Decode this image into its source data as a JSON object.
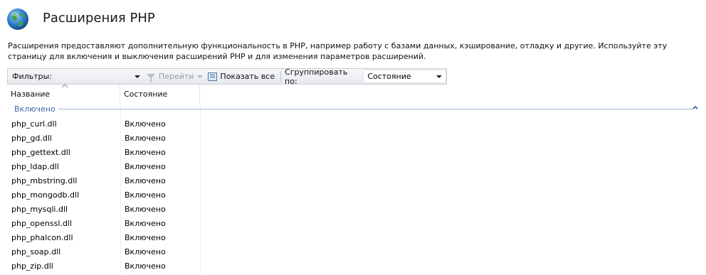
{
  "header": {
    "title": "Расширения PHP",
    "icon": "globe-icon"
  },
  "description": "Расширения предоставляют дополнительную функциональность в PHP, например работу с базами данных, кэширование, отладку и другие. Используйте эту страницу для включения и выключения расширений PHP и для изменения параметров расширений.",
  "toolbar": {
    "filter_label": "Фильтры:",
    "filter_value": "",
    "go_label": "Перейти",
    "show_all_label": "Показать все",
    "group_by_label": "Сгруппировать по:",
    "group_by_value": "Состояние"
  },
  "grid": {
    "columns": [
      "Название",
      "Состояние"
    ],
    "group": "Включено",
    "rows": [
      {
        "name": "php_curl.dll",
        "state": "Включено"
      },
      {
        "name": "php_gd.dll",
        "state": "Включено"
      },
      {
        "name": "php_gettext.dll",
        "state": "Включено"
      },
      {
        "name": "php_ldap.dll",
        "state": "Включено"
      },
      {
        "name": "php_mbstring.dll",
        "state": "Включено"
      },
      {
        "name": "php_mongodb.dll",
        "state": "Включено"
      },
      {
        "name": "php_mysqli.dll",
        "state": "Включено"
      },
      {
        "name": "php_openssl.dll",
        "state": "Включено"
      },
      {
        "name": "php_phalcon.dll",
        "state": "Включено"
      },
      {
        "name": "php_soap.dll",
        "state": "Включено"
      },
      {
        "name": "php_zip.dll",
        "state": "Включено"
      }
    ]
  },
  "colors": {
    "group_text": "#3b6aa6",
    "group_line": "#9db3d3",
    "toolbar_border": "#c7ccd4"
  }
}
